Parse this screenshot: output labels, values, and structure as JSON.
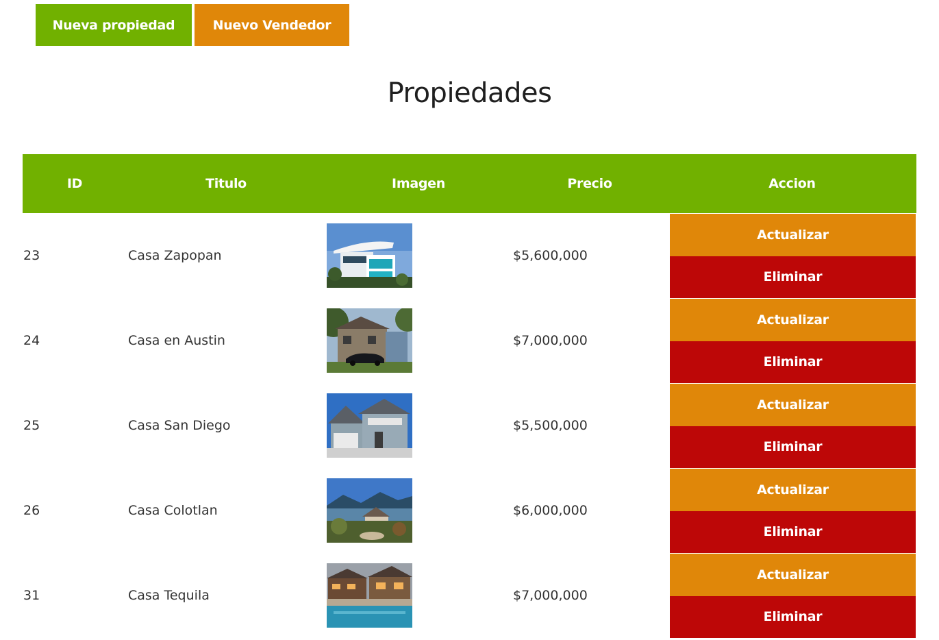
{
  "header": {
    "new_property_label": "Nueva propiedad",
    "new_seller_label": "Nuevo Vendedor"
  },
  "page_title": "Propiedades",
  "table": {
    "columns": [
      "ID",
      "Titulo",
      "Imagen",
      "Precio",
      "Accion"
    ],
    "rows": [
      {
        "id": "23",
        "title": "Casa Zapopan",
        "price": "$5,600,000",
        "image": "modern-house-photo",
        "update_label": "Actualizar",
        "delete_label": "Eliminar"
      },
      {
        "id": "24",
        "title": "Casa en Austin",
        "price": "$7,000,000",
        "image": "brick-house-photo",
        "update_label": "Actualizar",
        "delete_label": "Eliminar"
      },
      {
        "id": "25",
        "title": "Casa San Diego",
        "price": "$5,500,000",
        "image": "suburban-house-photo",
        "update_label": "Actualizar",
        "delete_label": "Eliminar"
      },
      {
        "id": "26",
        "title": "Casa Colotlan",
        "price": "$6,000,000",
        "image": "lake-house-photo",
        "update_label": "Actualizar",
        "delete_label": "Eliminar"
      },
      {
        "id": "31",
        "title": "Casa Tequila",
        "price": "$7,000,000",
        "image": "pool-house-photo",
        "update_label": "Actualizar",
        "delete_label": "Eliminar"
      }
    ]
  },
  "colors": {
    "green": "#71b100",
    "orange": "#e08709",
    "red": "#bd0707"
  }
}
